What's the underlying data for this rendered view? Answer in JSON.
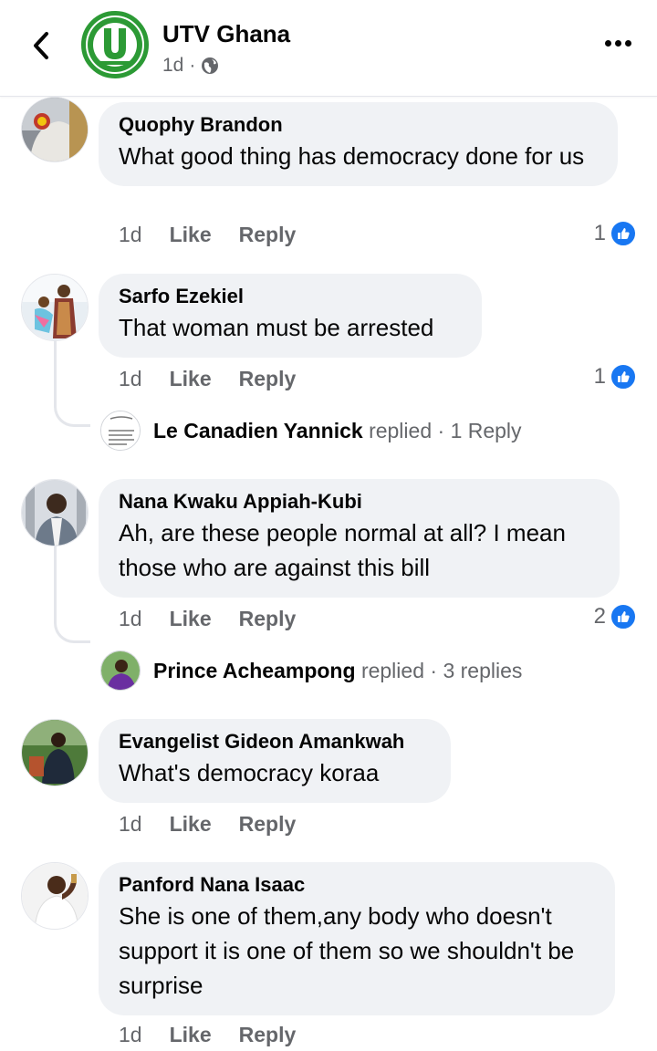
{
  "header": {
    "page_name": "UTV Ghana",
    "time": "1d",
    "separator": "·",
    "logo_letter": "U",
    "logo_sub": "TV"
  },
  "comments": [
    {
      "author": "Quophy Brandon",
      "text": "What good thing has democracy done for us",
      "time": "1d",
      "like_label": "Like",
      "reply_label": "Reply",
      "reaction_count": "1"
    },
    {
      "author": "Sarfo Ezekiel",
      "text": "That woman must be arrested",
      "time": "1d",
      "like_label": "Like",
      "reply_label": "Reply",
      "reaction_count": "1",
      "replies": {
        "name": "Le Canadien Yannick",
        "verb": "replied",
        "sep": "·",
        "count": "1 Reply"
      }
    },
    {
      "author": "Nana Kwaku Appiah-Kubi",
      "text": "Ah, are these people normal at all? I mean those who are against this bill",
      "time": "1d",
      "like_label": "Like",
      "reply_label": "Reply",
      "reaction_count": "2",
      "replies": {
        "name": "Prince Acheampong",
        "verb": "replied",
        "sep": "·",
        "count": "3 replies"
      }
    },
    {
      "author": "Evangelist Gideon Amankwah",
      "text": "What's democracy koraa",
      "time": "1d",
      "like_label": "Like",
      "reply_label": "Reply"
    },
    {
      "author": "Panford Nana Isaac",
      "text": "She is one of them,any body who doesn't support it is one of them so we shouldn't be surprise",
      "time": "1d",
      "like_label": "Like",
      "reply_label": "Reply"
    }
  ],
  "colors": {
    "brand_green": "#2c9a35",
    "like_blue": "#1877f2",
    "bubble_bg": "#f0f2f5",
    "secondary_text": "#65676b"
  },
  "icons": {
    "back": "chevron-left-icon",
    "globe": "globe-icon",
    "more": "more-options-icon",
    "like": "thumbs-up-icon"
  }
}
